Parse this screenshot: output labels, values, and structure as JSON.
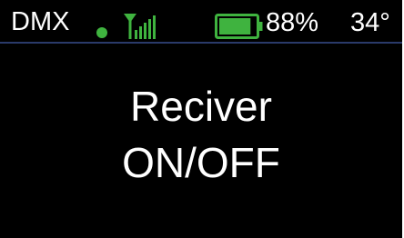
{
  "status_bar": {
    "mode_label": "DMX",
    "connection_icon": "status-dot",
    "connection_color": "#3fb33f",
    "signal_icon": "signal-bars-icon",
    "signal_color": "#3fb33f",
    "signal_bars_total": 5,
    "signal_bars_filled": 5,
    "battery_icon": "battery-icon",
    "battery_color": "#3fb33f",
    "battery_level": 0.88,
    "battery_text": "88%",
    "temperature_text": "34°"
  },
  "main": {
    "message_line_1": "Reciver",
    "message_line_2": "ON/OFF"
  },
  "colors": {
    "background": "#000000",
    "text": "#ffffff",
    "accent_green": "#3fb33f"
  }
}
